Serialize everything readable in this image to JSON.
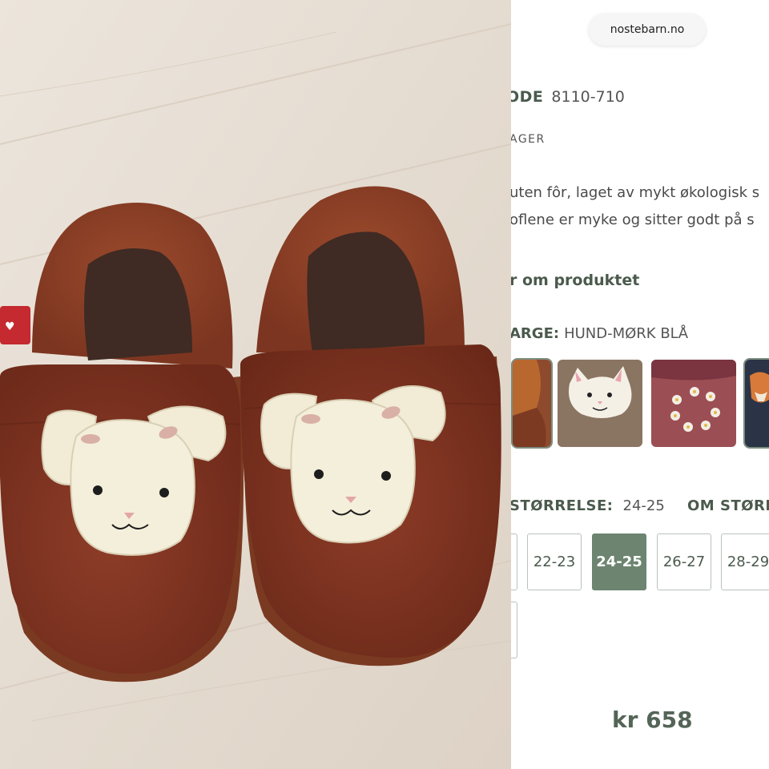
{
  "browser": {
    "url": "nostebarn.no"
  },
  "product": {
    "code_label": "ODE",
    "code_value": "8110-710",
    "stock_label": "AGER",
    "description_line1": "uten fôr, laget av mykt økologisk s",
    "description_line2": "oflene er myke og sitter godt på s",
    "more_link": "r om produktet",
    "color_label": "ARGE:",
    "color_value": "HUND-MØRK BLÅ",
    "color_thumbnails": [
      {
        "name": "brown-leather-variant",
        "selected": true
      },
      {
        "name": "cat-variant",
        "selected": false
      },
      {
        "name": "flower-wreath-variant",
        "selected": false
      },
      {
        "name": "fox-navy-variant",
        "selected": true
      }
    ],
    "size_label": "STØRRELSE:",
    "size_value": "24-25",
    "size_guide_label": "OM STØRF",
    "sizes": [
      {
        "label": "",
        "active": false
      },
      {
        "label": "22-23",
        "active": false
      },
      {
        "label": "24-25",
        "active": true
      },
      {
        "label": "26-27",
        "active": false
      },
      {
        "label": "28-29",
        "active": false
      },
      {
        "label": "",
        "active": false
      }
    ],
    "price": "kr 658"
  },
  "colors": {
    "accent_green": "#6c8470",
    "slipper_leather": "#8a3a26",
    "floor": "#e6dcd0"
  }
}
